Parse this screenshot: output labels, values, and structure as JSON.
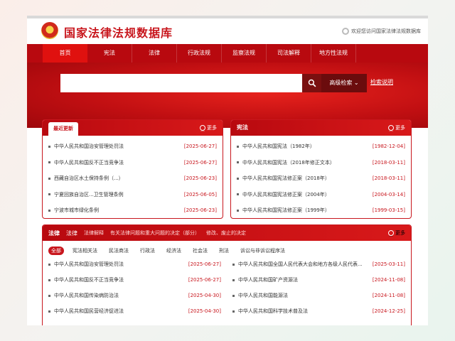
{
  "header": {
    "site_title": "国家法律法规数据库",
    "welcome": "欢迎您访问国家法律法规数据库"
  },
  "nav": [
    "首页",
    "宪法",
    "法律",
    "行政法规",
    "监察法规",
    "司法解释",
    "地方性法规"
  ],
  "search": {
    "placeholder": "",
    "advanced_label": "高级检索",
    "help_label": "检索说明"
  },
  "latest_panel": {
    "title": "最近更新",
    "more": "更多",
    "items": [
      {
        "title": "中华人民共和国治安管理处罚法",
        "date": "[2025-06-27]"
      },
      {
        "title": "中华人民共和国反不正当竞争法",
        "date": "[2025-06-27]"
      },
      {
        "title": "西藏自治区水土保持条例（...）",
        "date": "[2025-06-23]"
      },
      {
        "title": "宁夏回族自治区...卫生管理条例",
        "date": "[2025-06-05]"
      },
      {
        "title": "宁波市城市绿化条例",
        "date": "[2025-06-23]"
      }
    ]
  },
  "constitution_panel": {
    "title": "宪法",
    "more": "更多",
    "items": [
      {
        "title": "中华人民共和国宪法（1982年）",
        "date": "[1982-12-04]"
      },
      {
        "title": "中华人民共和国宪法（2018年修正文本）",
        "date": "[2018-03-11]"
      },
      {
        "title": "中华人民共和国宪法修正案（2018年）",
        "date": "[2018-03-11]"
      },
      {
        "title": "中华人民共和国宪法修正案（2004年）",
        "date": "[2004-03-14]"
      },
      {
        "title": "中华人民共和国宪法修正案（1999年）",
        "date": "[1999-03-15]"
      }
    ]
  },
  "law_panel": {
    "tabs": [
      "法律",
      "法律",
      "法律解释",
      "有关法律问题和重大问题的决定（部分）",
      "修改、废止的决定"
    ],
    "more": "更多",
    "filters": [
      "全部",
      "宪法相关法",
      "民法商法",
      "行政法",
      "经济法",
      "社会法",
      "刑法",
      "诉讼与非诉讼程序法"
    ],
    "left_items": [
      {
        "title": "中华人民共和国治安管理处罚法",
        "date": "[2025-06-27]"
      },
      {
        "title": "中华人民共和国反不正当竞争法",
        "date": "[2025-06-27]"
      },
      {
        "title": "中华人民共和国传染病防治法",
        "date": "[2025-04-30]"
      },
      {
        "title": "中华人民共和国民营经济促进法",
        "date": "[2025-04-30]"
      }
    ],
    "right_items": [
      {
        "title": "中华人民共和国全国人民代表大会和地方各级人民代表...",
        "date": "[2025-03-11]"
      },
      {
        "title": "中华人民共和国矿产资源法",
        "date": "[2024-11-08]"
      },
      {
        "title": "中华人民共和国能源法",
        "date": "[2024-11-08]"
      },
      {
        "title": "中华人民共和国科学技术普及法",
        "date": "[2024-12-25]"
      }
    ]
  },
  "colors": {
    "brand_red": "#c8161d",
    "nav_red": "#b8090f"
  }
}
